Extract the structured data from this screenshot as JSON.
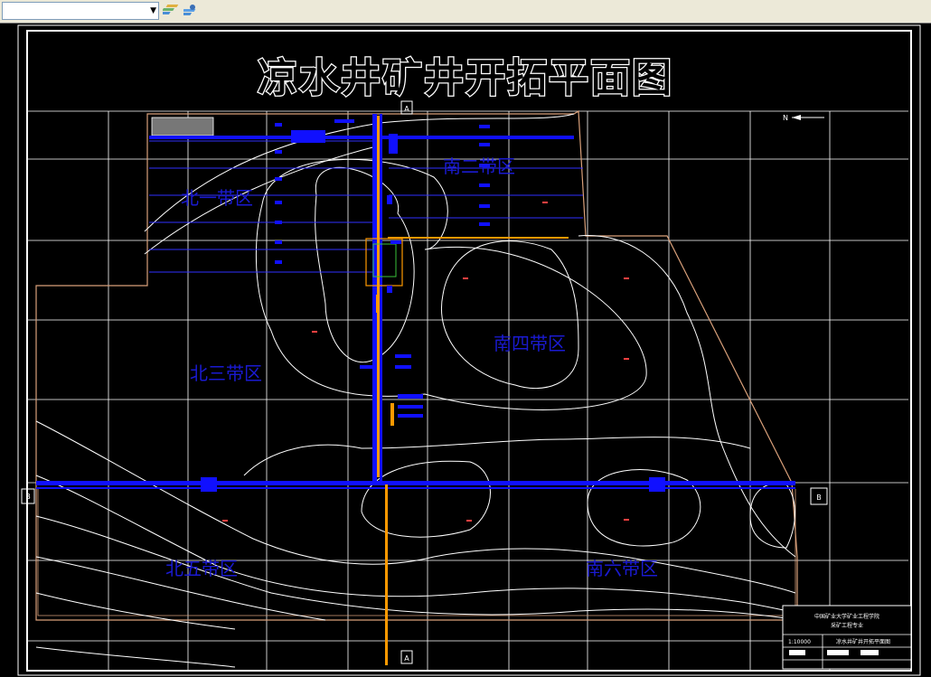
{
  "drawing": {
    "title": "凉水井矿井开拓平面图",
    "section_marks": {
      "a_top": "A",
      "a_bottom": "A",
      "b_left": "B",
      "b_right": "B"
    },
    "zones": {
      "north1": "北一带区",
      "north3": "北三带区",
      "north5": "北五带区",
      "south2": "南二带区",
      "south4": "南四带区",
      "south6": "南六带区"
    },
    "north_arrow": "N",
    "title_block": {
      "institute_line1": "中国矿业大学矿业工程学院",
      "institute_line2": "采矿工程专业",
      "drawing_name": "凉水井矿井开拓平面图",
      "scale": "1:10000"
    }
  },
  "toolbar": {
    "layer_combo_value": "",
    "icons": [
      "layer-previous-icon",
      "layer-states-icon"
    ]
  },
  "colors": {
    "background": "#000000",
    "grid": "#ffffff",
    "roadway": "#1010ff",
    "shaft": "#ff9900",
    "boundary": "#d9a07a",
    "zone_label": "#1a1ad0"
  }
}
